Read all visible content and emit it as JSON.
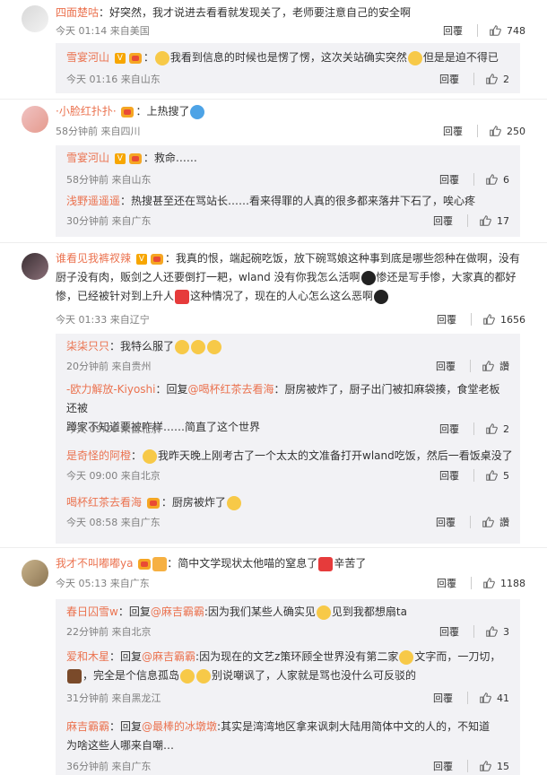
{
  "labels": {
    "reply": "回覆",
    "mark": "讚"
  },
  "comments": [
    {
      "user": "四面楚咕",
      "text": "：好突然，我才说进去看看就发现关了，老师要注意自己的安全啊",
      "time": "今天 01:14 来自美国",
      "likes": "748",
      "replies": [
        {
          "user": "雪宴河山",
          "text": "我看到信息的时候也是愣了愣，这次关站确实突然",
          "text2": "但是是迫不得已",
          "time": "今天 01:16 来自山东",
          "likes": "2"
        }
      ]
    },
    {
      "user": "·小脸红扑扑·",
      "text": "：上热搜了",
      "time": "58分钟前 来自四川",
      "likes": "250",
      "replies": [
        {
          "user": "雪宴河山",
          "text": "：救命……",
          "time": "58分钟前 来自山东",
          "likes": "6"
        },
        {
          "user": "浅野遥遥遥",
          "text": "：热搜甚至还在骂站长……看来得罪的人真的很多都来落井下石了，唉心疼",
          "time": "30分钟前 来自广东",
          "likes": "17"
        }
      ]
    },
    {
      "user": "谁看见我裤衩辣",
      "text": "：我真的恨，端起碗吃饭，放下碗骂娘这种事到底是哪些怨种在做啊，没有",
      "line2": "厨子没有肉，贩剑之人还要倒打一耙，wland 没有你我怎么活啊",
      "line2b": "惨还是写手惨，大家真的都好",
      "line3": "惨，已经被针对到上升人",
      "line3b": "这种情况了，现在的人心怎么这么恶啊",
      "time": "今天 01:33 来自辽宁",
      "likes": "1656",
      "replies": [
        {
          "user": "柒柒只只",
          "text": "：我特么服了",
          "time": "20分钟前 来自贵州",
          "likes": ""
        },
        {
          "user": "-欧力解放-Kiyoshi",
          "text": "：回复",
          "mention": "@喝杯红茶去看海",
          "text2": "：厨房被炸了，厨子出门被扣麻袋揍，食堂老板还被",
          "line2": "蹲家不知道要被咋样……简直了这个世界",
          "time": "今天 09:26 来自北京",
          "likes": "2"
        },
        {
          "user": "是奇怪的阿橙",
          "text": "：",
          "text2": "我昨天晚上刚考古了一个太太的文准备打开wland吃饭，然后一看饭桌没了",
          "time": "今天 09:00 来自北京",
          "likes": "5"
        },
        {
          "user": "喝杯红茶去看海",
          "text": "：厨房被炸了",
          "time": "今天 08:58 来自广东",
          "likes": ""
        }
      ]
    },
    {
      "user": "我才不叫嘟嘟ya",
      "text": "：简中文学现状太他喵的窒息了",
      "text2": "辛苦了",
      "time": "今天 05:13 来自广东",
      "likes": "1188",
      "replies": [
        {
          "user": "春日囚雪w",
          "text": "：回复",
          "mention": "@麻吉霸霸",
          "text2": ":因为我们某些人确实见",
          "text3": "见到我都想扇ta",
          "time": "22分钟前 来自北京",
          "likes": "3"
        },
        {
          "user": "爱和木星",
          "text": "：回复",
          "mention": "@麻吉霸霸",
          "text2": ":因为现在的文艺z策环顾全世界没有第二家",
          "text3": "文字而，一刀切，",
          "line2": "，完全是个信息孤岛",
          "line2b": "别说嘲讽了，人家就是骂也没什么可反驳的",
          "time": "31分钟前 来自黑龙江",
          "likes": "41"
        },
        {
          "user": "麻吉霸霸",
          "text": "：回复",
          "mention": "@最棒的冰墩墩",
          "text2": ":其实是湾湾地区拿来讽刺大陆用简体中文的人的，不知道",
          "line2": "为啥这些人哪来自嘲…",
          "time": "36分钟前 来自广东",
          "likes": "15"
        }
      ]
    }
  ]
}
